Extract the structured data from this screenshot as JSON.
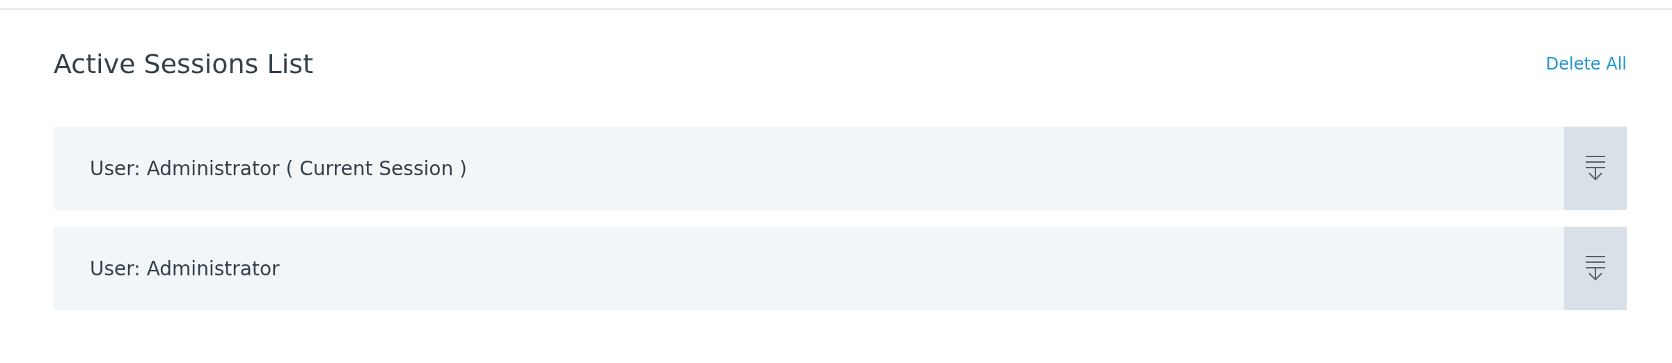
{
  "title": "Active Sessions List",
  "delete_all": "Delete All",
  "sessions": [
    {
      "label": "User: Administrator ( Current Session )"
    },
    {
      "label": "User: Administrator"
    }
  ]
}
